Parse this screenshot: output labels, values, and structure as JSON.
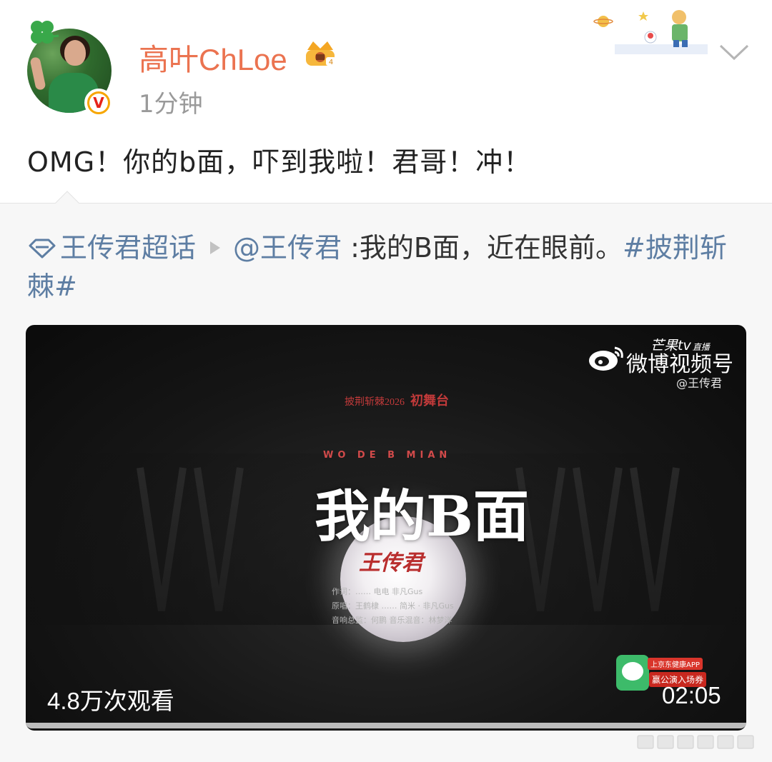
{
  "post": {
    "username": "高叶ChLoe",
    "timestamp": "1分钟",
    "text": "OMG！你的b面，吓到我啦！君哥！冲！"
  },
  "repost": {
    "supertopic": "王传君超话",
    "mention": "@王传君",
    "text": " :我的B面，近在眼前。",
    "hashtag": "#披荆斩棘#"
  },
  "video": {
    "show_logo": "披荆斩棘2026",
    "show_logo_stage": "初舞台",
    "song_subtitle": "WO DE B MIAN",
    "song_title": "我的B面",
    "singer": "王传君",
    "credits": {
      "lyrics": "作词：……  电电  非凡Gus",
      "original": "原唱：王鹤棣  ……  简米 · 非凡Gus",
      "sound": "音响总监：何鹏      音乐混音：林梦洋"
    },
    "brand_mango": "芒果tv",
    "brand_mango_tag": "直播",
    "brand_text": "微博视频号",
    "brand_handle": "@王传君",
    "sponsor_line1": "上京东健康APP",
    "sponsor_line2": "赢公演入场券",
    "view_count": "4.8万次观看",
    "duration": "02:05"
  },
  "icons": {
    "verified": "verified-badge-icon",
    "crown": "member-crown-icon",
    "menu": "chevron-down-icon",
    "supertopic": "diamond-icon",
    "weibo": "weibo-logo-icon"
  },
  "colors": {
    "username": "#eb7350",
    "link": "#5e7ea3",
    "verified": "#f7a600"
  }
}
